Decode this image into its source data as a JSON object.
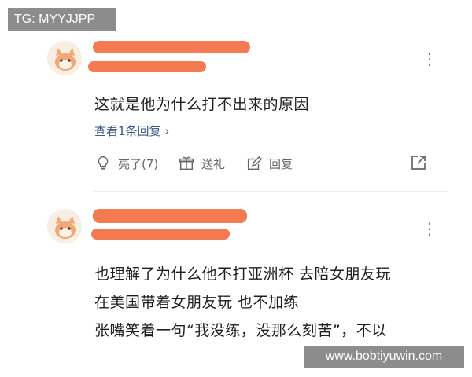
{
  "watermark_top": "TG: MYYJJPP",
  "watermark_bottom": "www.bobtiyuwin.com",
  "comment1": {
    "text": "这就是他为什么打不出来的原因",
    "view_replies": "查看1条回复",
    "actions": {
      "like": "亮了(7)",
      "gift": "送礼",
      "reply": "回复"
    },
    "icons": [
      "lightbulb-icon",
      "gift-icon",
      "edit-icon",
      "share-icon",
      "more-icon"
    ]
  },
  "comment2": {
    "lines": [
      "也理解了为什么他不打亚洲杯 去陪女朋友玩",
      "在美国带着女朋友玩 也不加练",
      "张嘴笑着一句“我没练，没那么刻苦”，不以"
    ],
    "icons": [
      "more-icon"
    ]
  },
  "colors": {
    "redaction": "#f47a52",
    "link": "#3b5b8a",
    "watermark_bg": "#8c8c8c"
  }
}
